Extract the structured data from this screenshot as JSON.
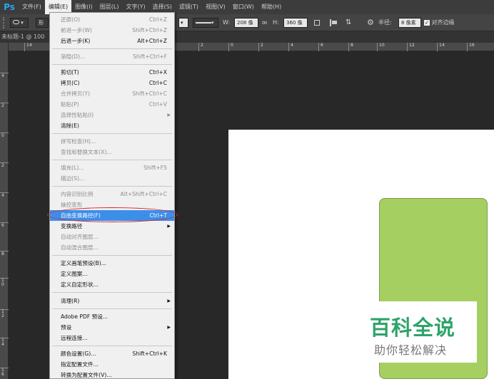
{
  "app": {
    "logo": "Ps"
  },
  "menubar": {
    "items": [
      "文件(F)",
      "编辑(E)",
      "图像(I)",
      "图层(L)",
      "文字(Y)",
      "选择(S)",
      "滤镜(T)",
      "视图(V)",
      "窗口(W)",
      "帮助(H)"
    ],
    "active_index": 1
  },
  "options": {
    "shape_label": "形",
    "w_label": "W:",
    "w_value": "208 像",
    "link_icon": "∞",
    "h_label": "H:",
    "h_value": "360 像",
    "radius_label": "半径:",
    "radius_value": "8 像素",
    "align_label": "对齐边缘"
  },
  "document": {
    "tab_label": "未标题-1 @ 100"
  },
  "rulers": {
    "h_ticks": [
      "14",
      "2",
      "0",
      "2",
      "4",
      "6",
      "8",
      "10",
      "12",
      "14",
      "16"
    ],
    "v_ticks": [
      "4",
      "2",
      "0",
      "2",
      "4",
      "6",
      "8",
      "1\n0",
      "1\n2",
      "1\n4",
      "1\n6"
    ]
  },
  "edit_menu": {
    "items": [
      {
        "label": "还原(O)",
        "shortcut": "Ctrl+Z",
        "disabled": true
      },
      {
        "label": "前进一步(W)",
        "shortcut": "Shift+Ctrl+Z",
        "disabled": true
      },
      {
        "label": "后退一步(K)",
        "shortcut": "Alt+Ctrl+Z",
        "disabled": false
      },
      {
        "label": "渐隐(D)...",
        "shortcut": "Shift+Ctrl+F",
        "disabled": true
      },
      {
        "label": "剪切(T)",
        "shortcut": "Ctrl+X",
        "disabled": false
      },
      {
        "label": "拷贝(C)",
        "shortcut": "Ctrl+C",
        "disabled": false
      },
      {
        "label": "合并拷贝(Y)",
        "shortcut": "Shift+Ctrl+C",
        "disabled": true
      },
      {
        "label": "粘贴(P)",
        "shortcut": "Ctrl+V",
        "disabled": true
      },
      {
        "label": "选择性粘贴(I)",
        "shortcut": "",
        "disabled": true,
        "submenu": true
      },
      {
        "label": "清除(E)",
        "shortcut": "",
        "disabled": false
      },
      {
        "label": "拼写检查(H)...",
        "shortcut": "",
        "disabled": true
      },
      {
        "label": "查找和替换文本(X)...",
        "shortcut": "",
        "disabled": true
      },
      {
        "label": "填充(L)...",
        "shortcut": "Shift+F5",
        "disabled": true
      },
      {
        "label": "描边(S)...",
        "shortcut": "",
        "disabled": true
      },
      {
        "label": "内容识别比例",
        "shortcut": "Alt+Shift+Ctrl+C",
        "disabled": true
      },
      {
        "label": "操控变形",
        "shortcut": "",
        "disabled": true
      },
      {
        "label": "自由变换路径(F)",
        "shortcut": "Ctrl+T",
        "disabled": false,
        "highlighted": true
      },
      {
        "label": "变换路径",
        "shortcut": "",
        "disabled": false,
        "submenu": true
      },
      {
        "label": "自动对齐图层...",
        "shortcut": "",
        "disabled": true
      },
      {
        "label": "自动混合图层...",
        "shortcut": "",
        "disabled": true
      },
      {
        "label": "定义画笔预设(B)...",
        "shortcut": "",
        "disabled": false
      },
      {
        "label": "定义图案...",
        "shortcut": "",
        "disabled": false
      },
      {
        "label": "定义自定形状...",
        "shortcut": "",
        "disabled": false
      },
      {
        "label": "清理(R)",
        "shortcut": "",
        "disabled": false,
        "submenu": true
      },
      {
        "label": "Adobe PDF 预设...",
        "shortcut": "",
        "disabled": false
      },
      {
        "label": "预设",
        "shortcut": "",
        "disabled": false,
        "submenu": true
      },
      {
        "label": "远程连接...",
        "shortcut": "",
        "disabled": false
      },
      {
        "label": "颜色设置(G)...",
        "shortcut": "Shift+Ctrl+K",
        "disabled": false
      },
      {
        "label": "指定配置文件...",
        "shortcut": "",
        "disabled": false
      },
      {
        "label": "转换为配置文件(V)...",
        "shortcut": "",
        "disabled": false
      }
    ]
  },
  "watermark": {
    "title": "百科全说",
    "subtitle": "助你轻松解决"
  },
  "colors": {
    "accent": "#3d8ee8",
    "shape_fill": "#a6cf62",
    "watermark_green": "#2ea36a",
    "annotation_red": "#d8242e"
  }
}
